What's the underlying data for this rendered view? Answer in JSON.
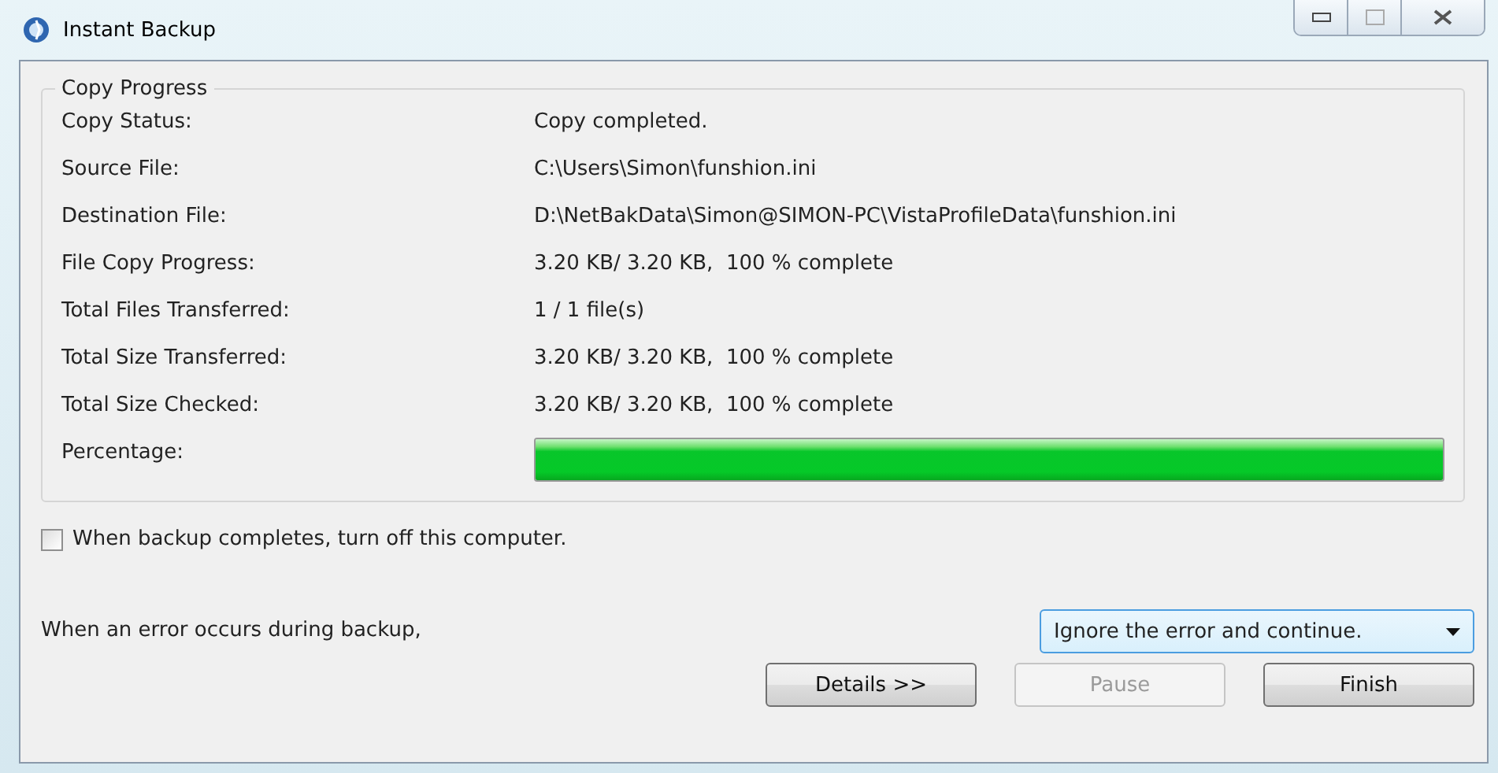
{
  "window": {
    "title": "Instant Backup"
  },
  "group": {
    "title": "Copy Progress",
    "rows": [
      {
        "label": "Copy Status:",
        "value": "Copy completed."
      },
      {
        "label": "Source File:",
        "value": "C:\\Users\\Simon\\funshion.ini"
      },
      {
        "label": "Destination File:",
        "value": "D:\\NetBakData\\Simon@SIMON-PC\\VistaProfileData\\funshion.ini"
      },
      {
        "label": "File Copy Progress:",
        "value": "3.20 KB/ 3.20 KB,  100 % complete"
      },
      {
        "label": "Total Files Transferred:",
        "value": "1 / 1 file(s)"
      },
      {
        "label": "Total Size Transferred:",
        "value": "3.20 KB/ 3.20 KB,  100 % complete"
      },
      {
        "label": "Total Size Checked:",
        "value": "3.20 KB/ 3.20 KB,  100 % complete"
      }
    ],
    "progress": {
      "label": "Percentage:",
      "level": 1
    }
  },
  "shutdown": {
    "label": "When backup completes, turn off this computer.",
    "checked": false
  },
  "error": {
    "label": "When an error occurs during backup,",
    "value": "Ignore the error and continue."
  },
  "buttons": [
    {
      "label": "Details >>",
      "disabled": false
    },
    {
      "label": "Pause",
      "disabled": true
    },
    {
      "label": "Finish",
      "disabled": false
    }
  ]
}
